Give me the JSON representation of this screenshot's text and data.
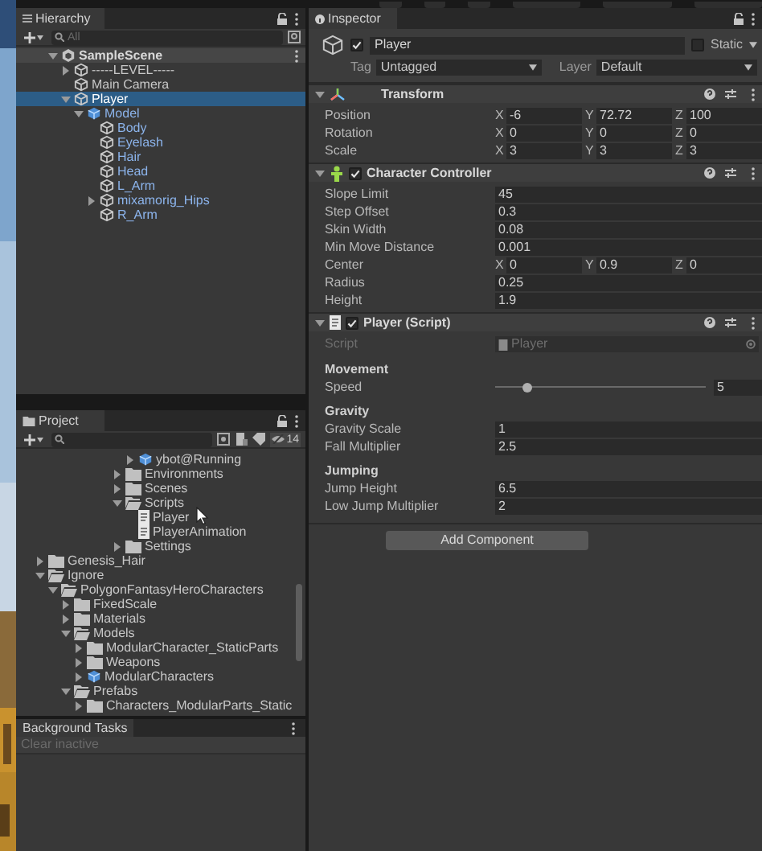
{
  "hierarchy": {
    "title": "Hierarchy",
    "search": {
      "placeholder": "All"
    },
    "tree": [
      {
        "label": "SampleScene",
        "kind": "scene",
        "expanded": true,
        "selected": false,
        "children": [
          {
            "label": "-----LEVEL-----",
            "kind": "object",
            "expanded": false,
            "selected": false
          },
          {
            "label": "Main Camera",
            "kind": "object",
            "selected": false
          },
          {
            "label": "Player",
            "kind": "object",
            "expanded": true,
            "selected": true,
            "children": [
              {
                "label": "Model",
                "kind": "prefab_root",
                "expanded": true,
                "selected": false,
                "children": [
                  {
                    "label": "Body",
                    "kind": "prefab_part",
                    "selected": false
                  },
                  {
                    "label": "Eyelash",
                    "kind": "prefab_part",
                    "selected": false
                  },
                  {
                    "label": "Hair",
                    "kind": "prefab_part",
                    "selected": false
                  },
                  {
                    "label": "Head",
                    "kind": "prefab_part",
                    "selected": false
                  },
                  {
                    "label": "L_Arm",
                    "kind": "prefab_part",
                    "selected": false
                  },
                  {
                    "label": "mixamorig_Hips",
                    "kind": "prefab_part",
                    "expanded": false,
                    "selected": false
                  },
                  {
                    "label": "R_Arm",
                    "kind": "prefab_part",
                    "selected": false
                  }
                ]
              }
            ]
          }
        ]
      }
    ]
  },
  "project": {
    "title": "Project",
    "hidden_count": "14",
    "tree": [
      {
        "children": [
          {
            "children": [
              {
                "children": [
                  {
                    "children": [
                      {
                        "children": [
                          {
                            "children": [
                              {
                                "children": [
                                  {
                                    "label": "ybot@Running",
                                    "kind": "prefab",
                                    "expanded": false
                                  }
                                ]
                              },
                              {
                                "label": "Environments",
                                "kind": "folder",
                                "expanded": false
                              },
                              {
                                "label": "Scenes",
                                "kind": "folder",
                                "expanded": false
                              },
                              {
                                "label": "Scripts",
                                "kind": "folder",
                                "expanded": true,
                                "children": [
                                  {
                                    "label": "Player",
                                    "kind": "script"
                                  },
                                  {
                                    "label": "PlayerAnimation",
                                    "kind": "script"
                                  }
                                ]
                              },
                              {
                                "label": "Settings",
                                "kind": "folder",
                                "expanded": false
                              }
                            ]
                          }
                        ]
                      }
                    ]
                  }
                ]
              }
            ]
          }
        ]
      },
      {
        "label": "Genesis_Hair",
        "kind": "folder",
        "expanded": false
      },
      {
        "label": "Ignore",
        "kind": "folder",
        "expanded": true,
        "children": [
          {
            "label": "PolygonFantasyHeroCharacters",
            "kind": "folder",
            "expanded": true,
            "children": [
              {
                "label": "FixedScale",
                "kind": "folder",
                "expanded": false
              },
              {
                "label": "Materials",
                "kind": "folder",
                "expanded": false
              },
              {
                "label": "Models",
                "kind": "folder",
                "expanded": true,
                "children": [
                  {
                    "label": "ModularCharacter_StaticParts",
                    "kind": "folder",
                    "expanded": false
                  },
                  {
                    "label": "Weapons",
                    "kind": "folder",
                    "expanded": false
                  },
                  {
                    "label": "ModularCharacters",
                    "kind": "prefab",
                    "expanded": false
                  }
                ]
              },
              {
                "label": "Prefabs",
                "kind": "folder",
                "expanded": true,
                "children": [
                  {
                    "label": "Characters_ModularParts_Static",
                    "kind": "folder",
                    "expanded": false
                  }
                ]
              }
            ]
          }
        ]
      }
    ]
  },
  "background_tasks": {
    "title": "Background Tasks",
    "clear_button": {
      "label": "Clear inactive",
      "disabled": true
    }
  },
  "inspector": {
    "title": "Inspector",
    "object": {
      "name": "Player",
      "active": true,
      "static_label": "Static",
      "static": false,
      "tag_label": "Tag",
      "tag": "Untagged",
      "layer_label": "Layer",
      "layer": "Default"
    },
    "components": [
      {
        "kind": "transform",
        "title": "Transform",
        "expanded": true,
        "rows": [
          {
            "kind": "vector",
            "label": "Position",
            "values": [
              {
                "axis": "X",
                "value": "-6"
              },
              {
                "axis": "Y",
                "value": "72.72"
              },
              {
                "axis": "Z",
                "value": "100"
              }
            ]
          },
          {
            "kind": "vector",
            "label": "Rotation",
            "values": [
              {
                "axis": "X",
                "value": "0"
              },
              {
                "axis": "Y",
                "value": "0"
              },
              {
                "axis": "Z",
                "value": "0"
              }
            ]
          },
          {
            "kind": "vector",
            "label": "Scale",
            "values": [
              {
                "axis": "X",
                "value": "3"
              },
              {
                "axis": "Y",
                "value": "3"
              },
              {
                "axis": "Z",
                "value": "3"
              }
            ]
          }
        ]
      },
      {
        "kind": "character_controller",
        "title": "Character Controller",
        "expanded": true,
        "enabled": true,
        "rows": [
          {
            "kind": "field",
            "label": "Slope Limit",
            "value": "45"
          },
          {
            "kind": "field",
            "label": "Step Offset",
            "value": "0.3"
          },
          {
            "kind": "field",
            "label": "Skin Width",
            "value": "0.08"
          },
          {
            "kind": "field",
            "label": "Min Move Distance",
            "value": "0.001"
          },
          {
            "kind": "vector",
            "label": "Center",
            "values": [
              {
                "axis": "X",
                "value": "0"
              },
              {
                "axis": "Y",
                "value": "0.9"
              },
              {
                "axis": "Z",
                "value": "0"
              }
            ]
          },
          {
            "kind": "field",
            "label": "Radius",
            "value": "0.25"
          },
          {
            "kind": "field",
            "label": "Height",
            "value": "1.9"
          }
        ]
      },
      {
        "kind": "script",
        "title": "Player (Script)",
        "expanded": true,
        "enabled": true,
        "rows": [
          {
            "kind": "object",
            "label": "Script",
            "value": "Player",
            "disabled": true
          },
          {
            "kind": "header",
            "label": "Movement"
          },
          {
            "kind": "slider",
            "label": "Speed",
            "level": 0.15,
            "value": "5"
          },
          {
            "kind": "header",
            "label": "Gravity"
          },
          {
            "kind": "field",
            "label": "Gravity Scale",
            "value": "1"
          },
          {
            "kind": "field",
            "label": "Fall Multiplier",
            "value": "2.5"
          },
          {
            "kind": "header",
            "label": "Jumping"
          },
          {
            "kind": "field",
            "label": "Jump Height",
            "value": "6.5"
          },
          {
            "kind": "field",
            "label": "Low Jump Multiplier",
            "value": "2"
          }
        ]
      }
    ],
    "add_button": "Add Component"
  }
}
